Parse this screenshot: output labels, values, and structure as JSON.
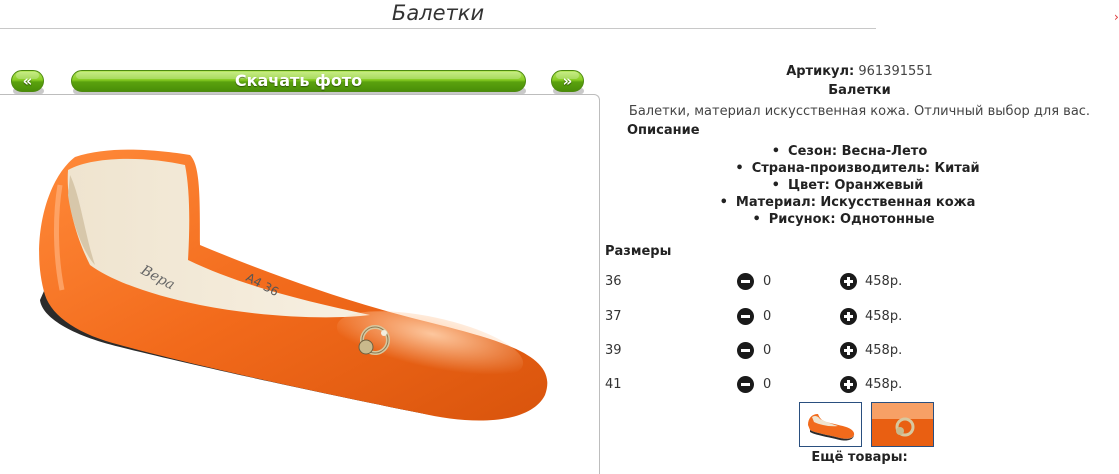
{
  "page": {
    "title": "Балетки"
  },
  "gallery": {
    "prev_label": "«",
    "download_label": "Скачать фото",
    "next_label": "»",
    "insole_print": "А4 36",
    "insole_brand": "Вера"
  },
  "product": {
    "article_label": "Артикул:",
    "article_value": "961391551",
    "name": "Балетки",
    "description": "Балетки, материал искусственная кожа. Отличный выбор для вас.",
    "description_title": "Описание",
    "features": [
      "Сезон: Весна-Лето",
      "Страна-производитель: Китай",
      "Цвет: Оранжевый",
      "Материал: Искусственная кожа",
      "Рисунок: Однотонные"
    ]
  },
  "sizes": {
    "title": "Размеры",
    "rows": [
      {
        "size": "36",
        "qty": "0",
        "price": "458р."
      },
      {
        "size": "37",
        "qty": "0",
        "price": "458р."
      },
      {
        "size": "39",
        "qty": "0",
        "price": "458р."
      },
      {
        "size": "41",
        "qty": "0",
        "price": "458р."
      }
    ]
  },
  "more_label": "Ещё товары:",
  "icons": {
    "minus": "minus-circle-icon",
    "plus": "plus-circle-icon"
  },
  "colors": {
    "accent_green": "#6ab516",
    "shoe_orange": "#f26a1b",
    "thumb_border": "#2a4f7f"
  }
}
